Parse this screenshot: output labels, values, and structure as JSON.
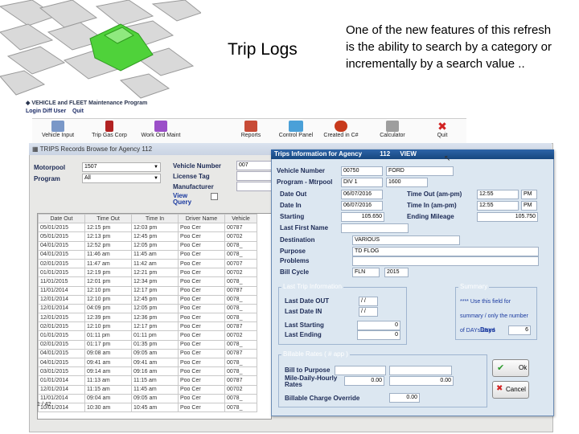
{
  "slide": {
    "title": "Trip Logs",
    "description": "One of the new features of this refresh is the ability to search by a category or incrementally by a search value .."
  },
  "app": {
    "title": "VEHICLE and FLEET Maintenance Program",
    "menu": [
      "Login Diff User",
      "Quit"
    ]
  },
  "toolbar": [
    {
      "label": "Vehicle Input",
      "icon": "vehicle-icon",
      "color": "#7a98c8"
    },
    {
      "label": "Trip Gas Corp",
      "icon": "gas-pump-icon",
      "color": "#b22222"
    },
    {
      "label": "Work Ord Maint",
      "icon": "tools-icon",
      "color": "#9b4fc8"
    },
    {
      "label": "Reports",
      "icon": "reports-icon",
      "color": "#c84b37"
    },
    {
      "label": "Control Panel",
      "icon": "control-panel-icon",
      "color": "#4aa0d8"
    },
    {
      "label": "Created in C#",
      "icon": "csharp-icon",
      "color": "#c83a1c"
    },
    {
      "label": "Calculator",
      "icon": "calculator-icon",
      "color": "#9e9e9e"
    },
    {
      "label": "Quit",
      "icon": "quit-icon",
      "color": "#d22222"
    }
  ],
  "browse": {
    "title": "TRIPS Records Browse for Agency 112",
    "labels": {
      "motorpool": "Motorpool",
      "program": "Program",
      "vehicle_number": "Vehicle Number",
      "license_tag": "License Tag",
      "manufacturer": "Manufacturer",
      "view_query": "View Query"
    },
    "motorpool_value": "1507",
    "program_value": "All",
    "vehicle_number_value": "007",
    "columns": [
      "Date Out",
      "Time Out",
      "Time In",
      "Driver Name",
      "Vehicle"
    ],
    "rows": [
      [
        "05/01/2015",
        "12:15 pm",
        "12:03 pm",
        "Poo Cer",
        "00787"
      ],
      [
        "05/01/2015",
        "12:13 pm",
        "12:45 pm",
        "Poo Cer",
        "00702"
      ],
      [
        "04/01/2015",
        "12:52 pm",
        "12:05 pm",
        "Poo Cer",
        "0078_"
      ],
      [
        "04/01/2015",
        "11:46 am",
        "11:45 am",
        "Poo Cer",
        "0078_"
      ],
      [
        "02/01/2015",
        "11:47 am",
        "11:42 am",
        "Poo Cer",
        "00707"
      ],
      [
        "01/01/2015",
        "12:19 pm",
        "12:21 pm",
        "Poo Cer",
        "00702"
      ],
      [
        "11/01/2015",
        "12:01 pm",
        "12:34 pm",
        "Poo Cer",
        "0078_"
      ],
      [
        "11/01/2014",
        "12:10 pm",
        "12:17 pm",
        "Poo Cer",
        "00787"
      ],
      [
        "12/01/2014",
        "12:10 pm",
        "12:45 pm",
        "Poo Cer",
        "0078_"
      ],
      [
        "12/01/2014",
        "04:09 pm",
        "12:05 pm",
        "Poo Cer",
        "0078_"
      ],
      [
        "12/01/2015",
        "12:39 pm",
        "12:36 pm",
        "Poo Cer",
        "0078_"
      ],
      [
        "02/01/2015",
        "12:10 pm",
        "12:17 pm",
        "Poo Cer",
        "00787"
      ],
      [
        "01/01/2015",
        "01:11 pm",
        "01:11 pm",
        "Poo Cer",
        "00702"
      ],
      [
        "02/01/2015",
        "01:17 pm",
        "01:35 pm",
        "Poo Cer",
        "0078_"
      ],
      [
        "04/01/2015",
        "09:08 am",
        "09:05 am",
        "Poo Cer",
        "00787"
      ],
      [
        "04/01/2015",
        "09:41 am",
        "09:41 am",
        "Poo Cer",
        "0078_"
      ],
      [
        "03/01/2015",
        "09:14 am",
        "09:16 am",
        "Poo Cer",
        "0078_"
      ],
      [
        "01/01/2014",
        "11:13 am",
        "11:15 am",
        "Poo Cer",
        "00787"
      ],
      [
        "12/01/2014",
        "11:15 am",
        "11:45 am",
        "Poo Cer",
        "00702"
      ],
      [
        "11/01/2014",
        "09:04 am",
        "09:05 am",
        "Poo Cer",
        "0078_"
      ],
      [
        "10/01/2014",
        "10:30 am",
        "10:45 am",
        "Poo Cer",
        "0078_"
      ]
    ],
    "footer": "1 / 42"
  },
  "dialog": {
    "title": "Trips Information for Agency",
    "title_agency": "112",
    "title_mode": "VIEW",
    "vehicle_number_label": "Vehicle Number",
    "vehicle_number": "00750",
    "vehicle_make": "FORD",
    "program_mtrpool_label": "Program - Mtrpool",
    "program": "DIV 1",
    "mtrpool": "1600",
    "date_out_label": "Date Out",
    "date_out": "06/07/2016",
    "time_out_label": "Time Out (am-pm)",
    "time_out": "12:55",
    "time_out_ampm": "PM",
    "date_in_label": "Date In",
    "date_in": "06/07/2016",
    "time_in_label": "Time In (am-pm)",
    "time_in": "12:55",
    "time_in_ampm": "PM",
    "starting_label": "Starting",
    "starting": "105.650",
    "ending_mileage_label": "Ending Mileage",
    "ending_mileage": "105.750",
    "last_first_name_label": "Last First Name",
    "destination_label": "Destination",
    "destination": "VARIOUS",
    "purpose_label": "Purpose",
    "purpose": "TD FLOG",
    "problems_label": "Problems",
    "bill_cycle_label": "Bill Cycle",
    "bill_cycle_a": "FLN",
    "bill_cycle_b": "2015",
    "last_trip_group": "Last Trip Information",
    "last_date_out_label": "Last Date OUT",
    "last_date_out": "/ /",
    "last_date_in_label": "Last Date IN",
    "last_date_in": "/ /",
    "last_starting_label": "Last Starting",
    "last_starting": "0",
    "last_ending_label": "Last Ending",
    "last_ending": "0",
    "summary_group": "Summary",
    "summary_note": "**** Use this field for summary / only the number of DAYs Used",
    "days_label": "Days",
    "days": "6",
    "billable_group": "Billable Rates ( # app )",
    "bill_to_purpose_label": "Bill to Purpose",
    "mile_daily_label": "Mile-Daily-Hourly Rates",
    "mile_daily": "0.00",
    "mile_daily_2": "0.00",
    "billable_override_label": "Billable Charge Override",
    "billable_override": "0.00",
    "ok_label": "Ok",
    "cancel_label": "Cancel"
  }
}
